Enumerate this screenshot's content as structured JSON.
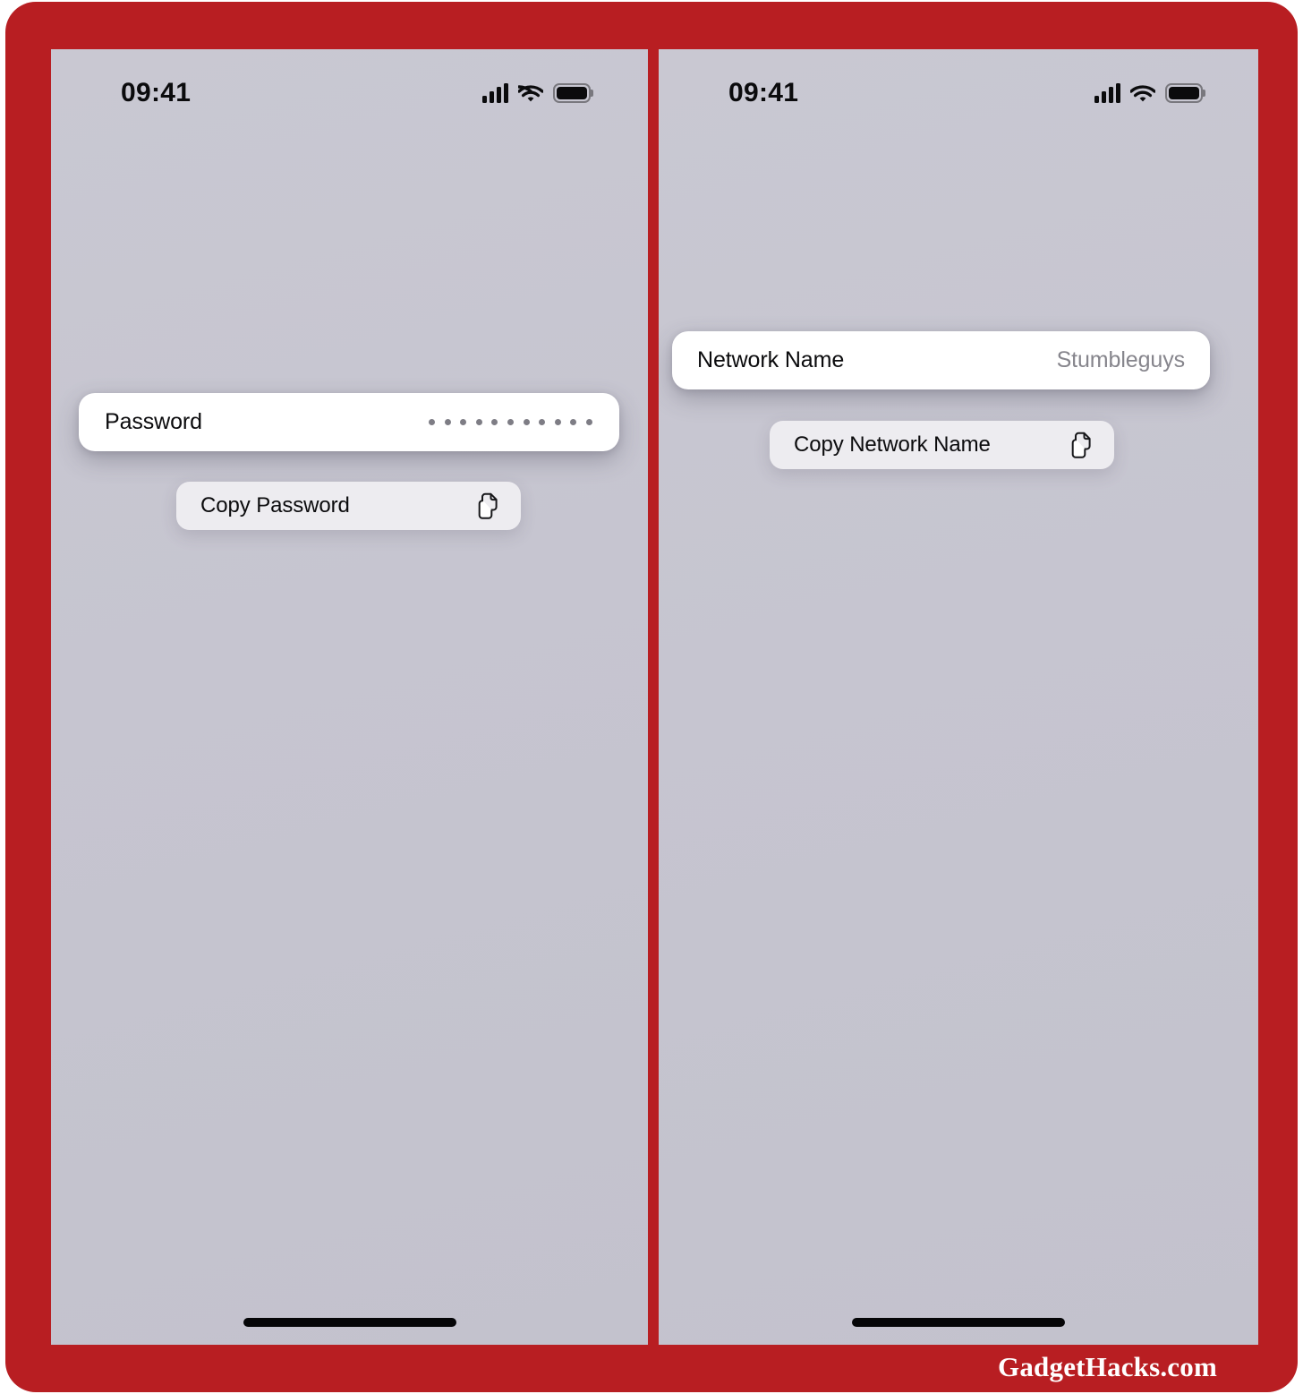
{
  "watermark": {
    "text": "GadgetHacks.com"
  },
  "theme": {
    "frame_color": "#B81E22",
    "screen_background": "#C6C5D0",
    "card_background": "#FFFFFF",
    "menu_background": "#EDECF0",
    "value_text_color": "#86858C"
  },
  "panels": [
    {
      "id": "password-panel",
      "status_bar": {
        "time": "09:41",
        "icons": [
          "cellular-icon",
          "wifi-icon",
          "battery-icon"
        ]
      },
      "card": {
        "label": "Password",
        "value_masked": true,
        "dot_count": 11
      },
      "copy_button": {
        "label": "Copy Password",
        "icon": "copy-icon"
      }
    },
    {
      "id": "network-name-panel",
      "status_bar": {
        "time": "09:41",
        "icons": [
          "cellular-icon",
          "wifi-icon",
          "battery-icon"
        ]
      },
      "card": {
        "label": "Network Name",
        "value": "Stumbleguys",
        "value_masked": false
      },
      "copy_button": {
        "label": "Copy Network Name",
        "icon": "copy-icon"
      }
    }
  ]
}
